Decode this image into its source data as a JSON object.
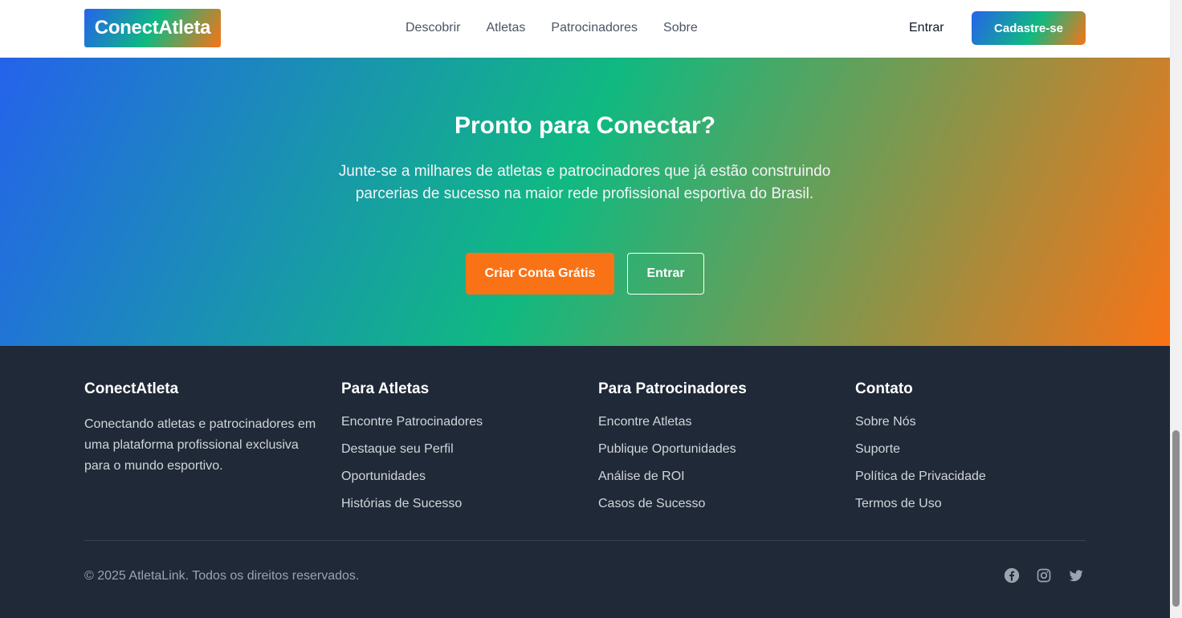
{
  "header": {
    "logo": "ConectAtleta",
    "nav": [
      "Descobrir",
      "Atletas",
      "Patrocinadores",
      "Sobre"
    ],
    "login_label": "Entrar",
    "signup_label": "Cadastre-se"
  },
  "hero": {
    "title": "Pronto para Conectar?",
    "subtitle": "Junte-se a milhares de atletas e patrocinadores que já estão construindo parcerias de sucesso na maior rede profissional esportiva do Brasil.",
    "primary_cta": "Criar Conta Grátis",
    "secondary_cta": "Entrar"
  },
  "footer": {
    "brand": {
      "title": "ConectAtleta",
      "description": "Conectando atletas e patrocinadores em uma plataforma profissional exclusiva para o mundo esportivo."
    },
    "columns": [
      {
        "title": "Para Atletas",
        "links": [
          "Encontre Patrocinadores",
          "Destaque seu Perfil",
          "Oportunidades",
          "Histórias de Sucesso"
        ]
      },
      {
        "title": "Para Patrocinadores",
        "links": [
          "Encontre Atletas",
          "Publique Oportunidades",
          "Análise de ROI",
          "Casos de Sucesso"
        ]
      },
      {
        "title": "Contato",
        "links": [
          "Sobre Nós",
          "Suporte",
          "Política de Privacidade",
          "Termos de Uso"
        ]
      }
    ],
    "copyright": "© 2025 AtletaLink. Todos os direitos reservados.",
    "socials": [
      "facebook-icon",
      "instagram-icon",
      "twitter-icon"
    ]
  },
  "colors": {
    "brand_blue": "#2563eb",
    "brand_green": "#10b981",
    "brand_orange": "#f97316",
    "footer_bg": "#1f2937"
  }
}
